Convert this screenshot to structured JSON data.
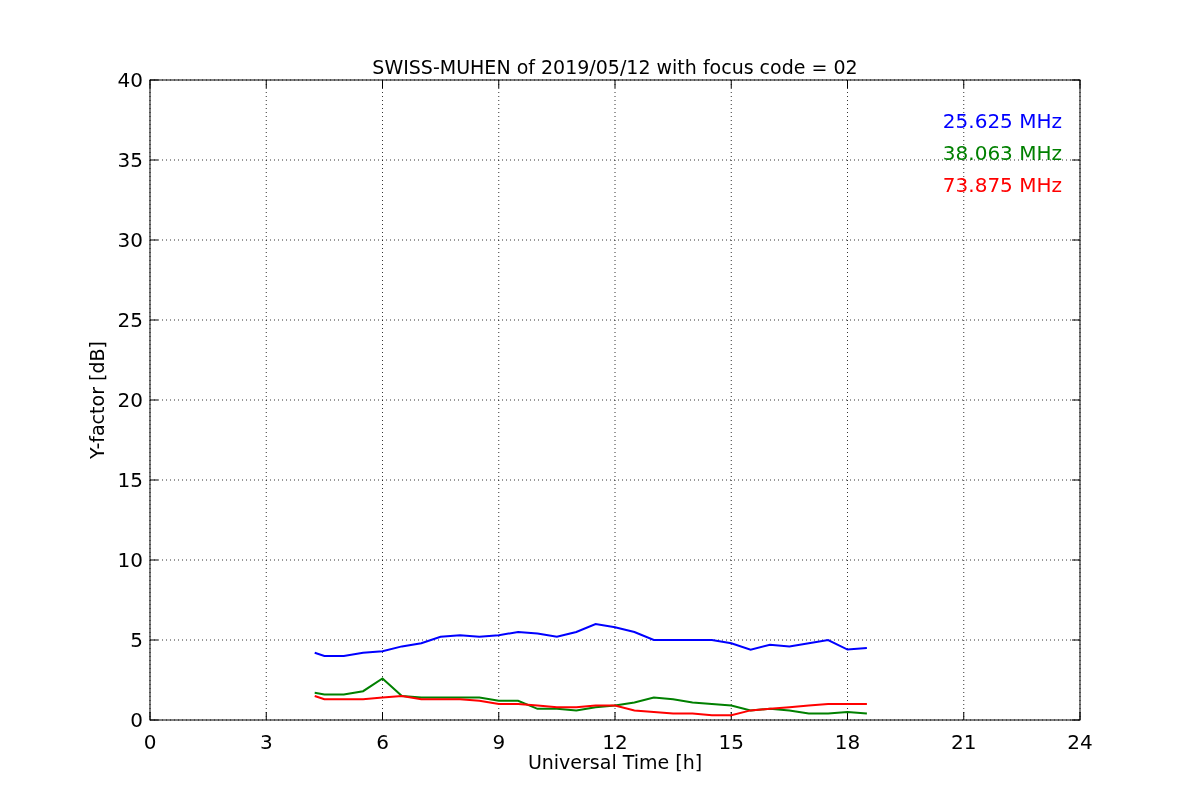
{
  "figure": {
    "chart_data": {
      "type": "line",
      "title": "SWISS-MUHEN of 2019/05/12 with focus code = 02",
      "xlabel": "Universal Time [h]",
      "ylabel": "Y-factor [dB]",
      "x": [
        4.25,
        4.5,
        5,
        5.5,
        6,
        6.5,
        7,
        7.5,
        8,
        8.5,
        9,
        9.5,
        10,
        10.5,
        11,
        11.5,
        12,
        12.5,
        13,
        13.5,
        14,
        14.5,
        15,
        15.5,
        16,
        16.5,
        17,
        17.5,
        18,
        18.5
      ],
      "series": [
        {
          "name": "25.625 MHz",
          "color": "#0000ff",
          "values": [
            4.2,
            4.0,
            4.0,
            4.2,
            4.3,
            4.6,
            4.8,
            5.2,
            5.3,
            5.2,
            5.3,
            5.5,
            5.4,
            5.2,
            5.5,
            6.0,
            5.8,
            5.5,
            5.0,
            5.0,
            5.0,
            5.0,
            4.8,
            4.4,
            4.7,
            4.6,
            4.8,
            5.0,
            4.4,
            4.5
          ]
        },
        {
          "name": "38.063 MHz",
          "color": "#008000",
          "values": [
            1.7,
            1.6,
            1.6,
            1.8,
            2.6,
            1.5,
            1.4,
            1.4,
            1.4,
            1.4,
            1.2,
            1.2,
            0.7,
            0.7,
            0.6,
            0.8,
            0.9,
            1.1,
            1.4,
            1.3,
            1.1,
            1.0,
            0.9,
            0.6,
            0.7,
            0.6,
            0.4,
            0.4,
            0.5,
            0.4
          ]
        },
        {
          "name": "73.875 MHz",
          "color": "#ff0000",
          "values": [
            1.5,
            1.3,
            1.3,
            1.3,
            1.4,
            1.5,
            1.3,
            1.3,
            1.3,
            1.2,
            1.0,
            1.0,
            0.9,
            0.8,
            0.8,
            0.9,
            0.9,
            0.6,
            0.5,
            0.4,
            0.4,
            0.3,
            0.3,
            0.6,
            0.7,
            0.8,
            0.9,
            1.0,
            1.0,
            1.0
          ]
        }
      ],
      "grid": true,
      "xlim": [
        0,
        24
      ],
      "ylim": [
        0,
        40
      ],
      "xticks": [
        0,
        3,
        6,
        9,
        12,
        15,
        18,
        21,
        24
      ],
      "yticks": [
        0,
        5,
        10,
        15,
        20,
        25,
        30,
        35,
        40
      ]
    }
  }
}
